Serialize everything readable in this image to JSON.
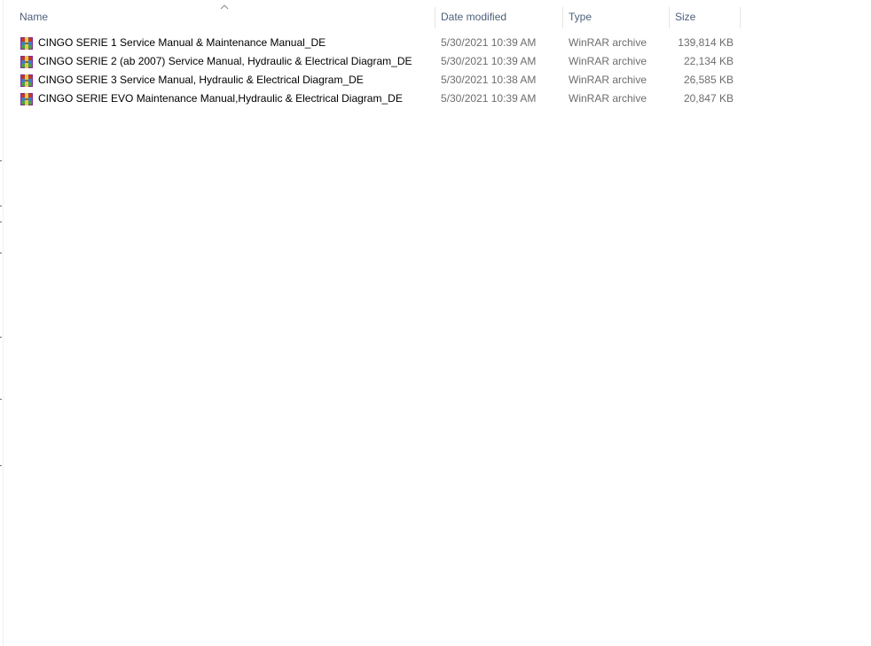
{
  "columns": {
    "name": "Name",
    "date": "Date modified",
    "type": "Type",
    "size": "Size"
  },
  "sort": {
    "column": "name",
    "direction": "ascending",
    "icon": "chevron-up-icon"
  },
  "files": [
    {
      "name": "CINGO SERIE 1 Service Manual & Maintenance Manual_DE",
      "date": "5/30/2021 10:39 AM",
      "type": "WinRAR archive",
      "size": "139,814 KB",
      "icon": "winrar-archive-icon"
    },
    {
      "name": "CINGO SERIE 2 (ab 2007) Service Manual, Hydraulic & Electrical Diagram_DE",
      "date": "5/30/2021 10:39 AM",
      "type": "WinRAR archive",
      "size": "22,134 KB",
      "icon": "winrar-archive-icon"
    },
    {
      "name": "CINGO SERIE 3 Service Manual, Hydraulic & Electrical Diagram_DE",
      "date": "5/30/2021 10:38 AM",
      "type": "WinRAR archive",
      "size": "26,585 KB",
      "icon": "winrar-archive-icon"
    },
    {
      "name": "CINGO SERIE EVO Maintenance Manual,Hydraulic & Electrical Diagram_DE",
      "date": "5/30/2021 10:39 AM",
      "type": "WinRAR archive",
      "size": "20,847 KB",
      "icon": "winrar-archive-icon"
    }
  ],
  "colors": {
    "header_text": "#4c607a",
    "secondary_text": "#6d6d6d"
  }
}
